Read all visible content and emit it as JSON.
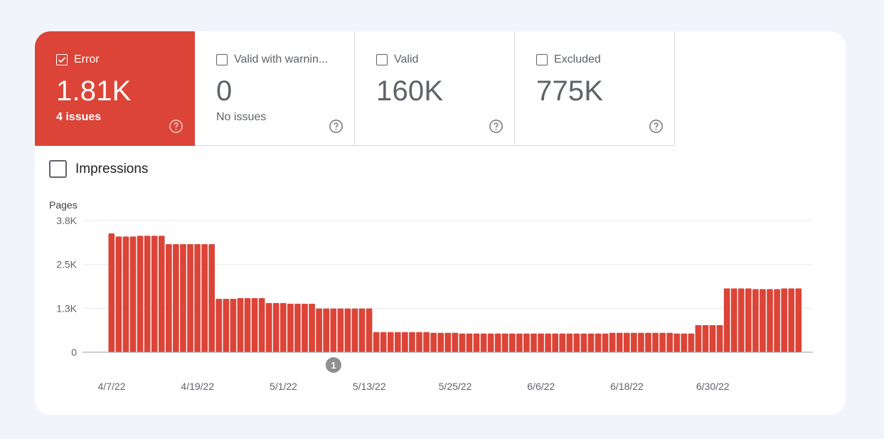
{
  "tiles": [
    {
      "label": "Error",
      "value": "1.81K",
      "sub": "4 issues",
      "checked": true
    },
    {
      "label": "Valid with warnin...",
      "value": "0",
      "sub": "No issues",
      "checked": false
    },
    {
      "label": "Valid",
      "value": "160K",
      "sub": "",
      "checked": false
    },
    {
      "label": "Excluded",
      "value": "775K",
      "sub": "",
      "checked": false
    }
  ],
  "impressions": {
    "label": "Impressions",
    "checked": false
  },
  "colors": {
    "error": "#db4437",
    "text": "#5f6368",
    "grid": "#e8eaed"
  },
  "icons": {
    "help": "help-circle-icon",
    "check": "checkmark-icon",
    "annotation": "annotation-marker"
  },
  "annotation": {
    "label": "1",
    "date_index": 31
  },
  "chart_data": {
    "type": "bar",
    "ylabel": "Pages",
    "ylim": [
      0,
      3800
    ],
    "yticks": [
      "0",
      "1.3K",
      "2.5K",
      "3.8K"
    ],
    "ytick_values": [
      0,
      1266.67,
      2533.33,
      3800
    ],
    "x_tick_labels": [
      "4/7/22",
      "4/19/22",
      "5/1/22",
      "5/13/22",
      "5/25/22",
      "6/6/22",
      "6/18/22",
      "6/30/22"
    ],
    "x_start": "4/7/22",
    "x_end": "7/4/22",
    "grid": true,
    "series": [
      {
        "values": [
          3430,
          3340,
          3340,
          3340,
          3360,
          3360,
          3360,
          3360,
          3120,
          3120,
          3120,
          3120,
          3120,
          3120,
          3120,
          1540,
          1540,
          1540,
          1560,
          1560,
          1560,
          1560,
          1420,
          1420,
          1420,
          1400,
          1400,
          1400,
          1400,
          1260,
          1260,
          1260,
          1260,
          1260,
          1260,
          1260,
          1260,
          580,
          580,
          580,
          580,
          580,
          580,
          580,
          580,
          560,
          560,
          560,
          560,
          540,
          540,
          540,
          540,
          540,
          540,
          540,
          540,
          540,
          540,
          540,
          540,
          540,
          540,
          540,
          540,
          540,
          540,
          540,
          540,
          540,
          560,
          560,
          560,
          560,
          560,
          560,
          560,
          560,
          560,
          540,
          540,
          540,
          780,
          780,
          780,
          780,
          1840,
          1840,
          1840,
          1840,
          1820,
          1820,
          1820,
          1820,
          1840,
          1840,
          1840
        ]
      }
    ]
  }
}
